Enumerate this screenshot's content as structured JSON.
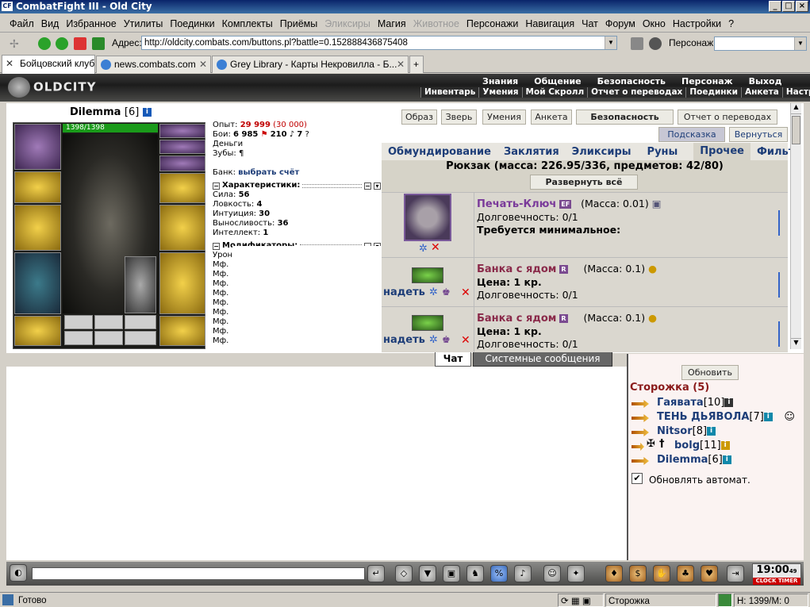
{
  "window": {
    "title": "CombatFight III - Old City",
    "app_icon": "CF"
  },
  "menu": [
    "Файл",
    "Вид",
    "Избранное",
    "Утилиты",
    "Поединки",
    "Комплекты",
    "Приёмы",
    "Эликсиры",
    "Магия",
    "Животное",
    "Персонажи",
    "Навигация",
    "Чат",
    "Форум",
    "Окно",
    "Настройки",
    "?"
  ],
  "address": {
    "label": "Адрес:",
    "url": "http://oldcity.combats.com/buttons.pl?battle=0.152888436875408",
    "char_label": "Персонаж:"
  },
  "tabs": [
    "Бойцовский клуб",
    "news.combats.com",
    "Grey Library - Карты Некровилла - Б..."
  ],
  "game": {
    "logo": "OLDCITY",
    "top_nav": [
      "Знания",
      "Общение",
      "Безопасность",
      "Персонаж",
      "Выход"
    ],
    "sub_nav": [
      "Инвентарь",
      "Умения",
      "Мой Скролл",
      "Отчет о переводах",
      "Поединки",
      "Анкета",
      "Настро"
    ],
    "char": {
      "name": "Dilemma",
      "level": "[6]",
      "hp": "1398/1398"
    },
    "stats": {
      "exp_label": "Опыт:",
      "exp_value": "29 999",
      "exp_next": "(30 000)",
      "fights_label": "Бои:",
      "wins": "6 985",
      "losses": "210",
      "draws": "7",
      "money_label": "Деньги",
      "teeth_label": "Зубы:",
      "bank_label": "Банк:",
      "bank_link": "выбрать счёт",
      "char_header": "Характеристики:",
      "attrs": [
        {
          "k": "Сила:",
          "v": "56"
        },
        {
          "k": "Ловкость:",
          "v": "4"
        },
        {
          "k": "Интуиция:",
          "v": "30"
        },
        {
          "k": "Выносливость:",
          "v": "36"
        },
        {
          "k": "Интеллект:",
          "v": "1"
        }
      ],
      "mod_header": "Модификаторы:",
      "mods": [
        "Урон",
        "Мф.",
        "Мф.",
        "Мф.",
        "Мф.",
        "Мф.",
        "Мф.",
        "Мф.",
        "Мф.",
        "Мф."
      ]
    },
    "buttons": {
      "obraz": "Образ",
      "beast": "Зверь",
      "skills": "Умения",
      "anketa": "Анкета",
      "security": "Безопасность",
      "transfers": "Отчет о переводах",
      "hint": "Подсказка",
      "back": "Вернуться",
      "expand": "Развернуть всё"
    },
    "inv_tabs": [
      "Обмундирование",
      "Заклятия",
      "Эликсиры",
      "Руны",
      "Прочее",
      "Фильтр"
    ],
    "backpack": "Рюкзак (масса: 226.95/336, предметов: 42/80)",
    "items": [
      {
        "name": "Печать-Ключ",
        "tag": "EF",
        "mass": "(Масса: 0.01)",
        "line2": "Долговечность: 0/1",
        "line3": "Требуется минимальное:",
        "action": ""
      },
      {
        "name": "Банка с ядом",
        "tag": "R",
        "mass": "(Масса: 0.1)",
        "line2": "Цена: 1 кр.",
        "line3": "Долговечность: 0/1",
        "action": "надеть"
      },
      {
        "name": "Банка с ядом",
        "tag": "R",
        "mass": "(Масса: 0.1)",
        "line2": "Цена: 1 кр.",
        "line3": "Долговечность: 0/1",
        "action": "надеть"
      }
    ]
  },
  "chat": {
    "tab_chat": "Чат",
    "tab_system": "Системные сообщения"
  },
  "side": {
    "refresh": "Обновить",
    "room": "Сторожка (5)",
    "players": [
      {
        "name": "Гаявата",
        "lvl": "[10]"
      },
      {
        "name": "ТЕНЬ ДЬЯВОЛА",
        "lvl": "[7]"
      },
      {
        "name": "Nitsor",
        "lvl": "[8]"
      },
      {
        "name": "bolg",
        "lvl": "[11]"
      },
      {
        "name": "Dilemma",
        "lvl": "[6]"
      }
    ],
    "auto_refresh": "Обновлять автомат."
  },
  "clock": {
    "time": "19:00",
    "sec": "49",
    "label1": "CLOCK",
    "label2": "TIMER"
  },
  "status": {
    "ready": "Готово",
    "location": "Сторожка",
    "hp": "H: 1399/M: 0"
  }
}
